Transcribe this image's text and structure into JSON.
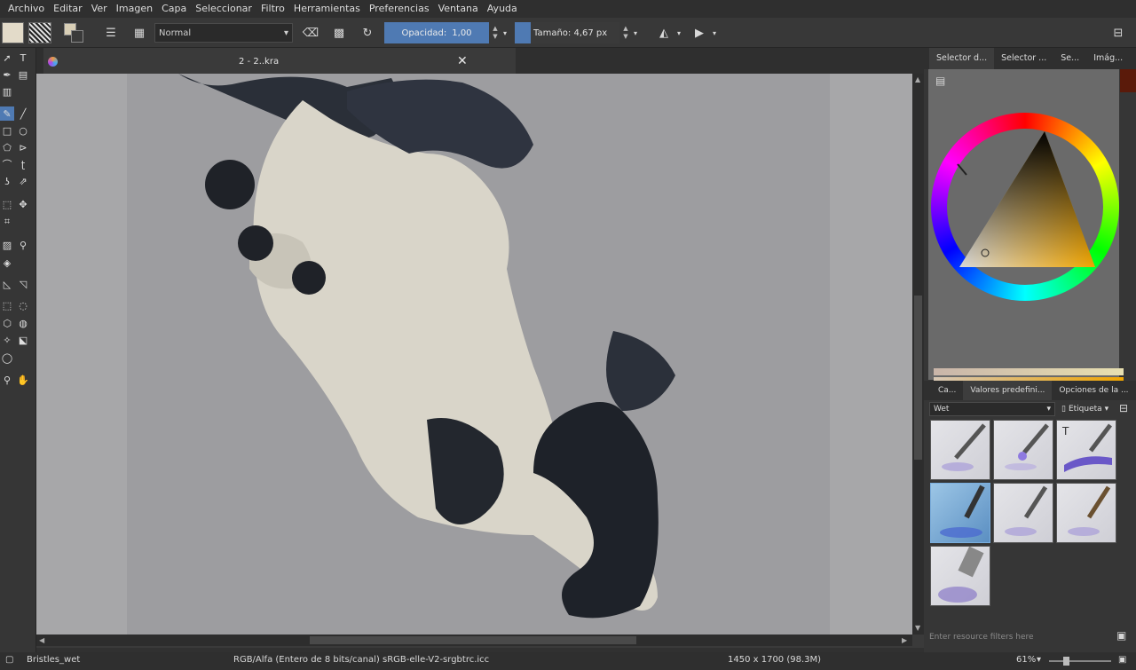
{
  "menu": [
    "Archivo",
    "Editar",
    "Ver",
    "Imagen",
    "Capa",
    "Seleccionar",
    "Filtro",
    "Herramientas",
    "Preferencias",
    "Ventana",
    "Ayuda"
  ],
  "toolbar": {
    "blend_mode": "Normal",
    "opacity_label": "Opacidad:",
    "opacity_value": "1,00",
    "size_label": "Tamaño:",
    "size_value": "4,67 px"
  },
  "document": {
    "tab_title": "2 - 2..kra"
  },
  "dock": {
    "top_tabs": [
      "Selector d...",
      "Selector ...",
      "Se...",
      "Imág..."
    ],
    "preset_tabs": [
      "Ca...",
      "Valores predefini...",
      "Opciones de la ..."
    ],
    "preset_filter": "Wet",
    "tag_label": "Etiqueta",
    "filter_placeholder": "Enter resource filters here"
  },
  "status": {
    "brush": "Bristles_wet",
    "colorspace": "RGB/Alfa (Entero de 8 bits/canal)  sRGB-elle-V2-srgbtrc.icc",
    "dimensions": "1450 x 1700 (98.3M)",
    "zoom": "61%"
  },
  "colors": {
    "accent": "#4f7ab3",
    "canvas_bg": "#a7a7a9",
    "paper": "#9d9da0"
  },
  "icons": [
    "pointer-icon",
    "text-icon",
    "brush-icon",
    "eraser-icon",
    "rect-icon",
    "ellipse-icon",
    "zoom-icon",
    "pan-icon",
    "close-icon"
  ]
}
